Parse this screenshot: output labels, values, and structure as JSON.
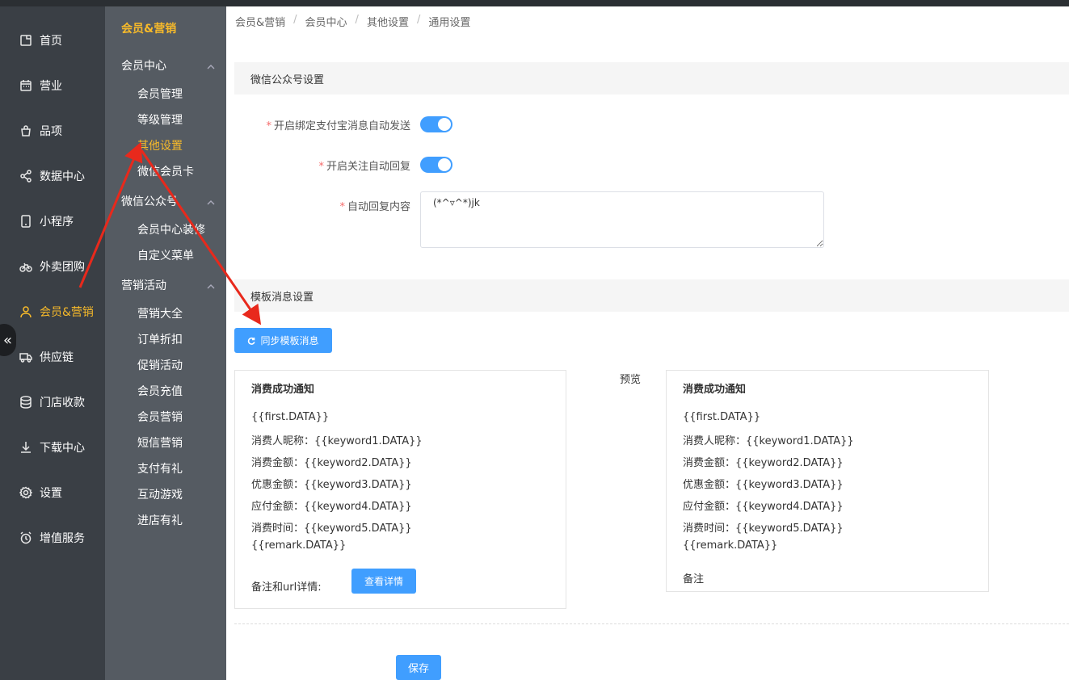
{
  "nav_primary": [
    {
      "label": "首页",
      "icon": "home-icon"
    },
    {
      "label": "营业",
      "icon": "calendar-icon"
    },
    {
      "label": "品项",
      "icon": "bag-icon"
    },
    {
      "label": "数据中心",
      "icon": "share-icon"
    },
    {
      "label": "小程序",
      "icon": "tablet-icon"
    },
    {
      "label": "外卖团购",
      "icon": "bicycle-icon"
    },
    {
      "label": "会员&营销",
      "icon": "user-icon"
    },
    {
      "label": "供应链",
      "icon": "truck-icon"
    },
    {
      "label": "门店收款",
      "icon": "database-icon"
    },
    {
      "label": "下载中心",
      "icon": "download-icon"
    },
    {
      "label": "设置",
      "icon": "gear-icon"
    },
    {
      "label": "增值服务",
      "icon": "alarm-icon"
    }
  ],
  "nav_secondary": {
    "heading": "会员&营销",
    "groups": [
      {
        "label": "会员中心",
        "items": [
          "会员管理",
          "等级管理",
          "其他设置",
          "微信会员卡"
        ]
      },
      {
        "label": "微信公众号",
        "items": [
          "会员中心装修",
          "自定义菜单"
        ]
      },
      {
        "label": "营销活动",
        "items": [
          "营销大全",
          "订单折扣",
          "促销活动",
          "会员充值",
          "会员营销",
          "短信营销",
          "支付有礼",
          "互动游戏",
          "进店有礼"
        ]
      }
    ]
  },
  "breadcrumb": [
    "会员&营销",
    "会员中心",
    "其他设置",
    "通用设置"
  ],
  "breadcrumb_sep": "/",
  "wechat_section": {
    "title": "微信公众号设置",
    "required_mark": "*",
    "alipay_label": "开启绑定支付宝消息自动发送",
    "follow_label": "开启关注自动回复",
    "reply_label": "自动回复内容",
    "reply_value": "(*^▿^*)jk"
  },
  "template_section": {
    "title": "模板消息设置",
    "sync_button": "同步模板消息",
    "preview_label": "预览",
    "card": {
      "title": "消费成功通知",
      "lines": [
        "{{first.DATA}}",
        "消费人昵称：{{keyword1.DATA}}",
        "消费金额：{{keyword2.DATA}}",
        "优惠金额：{{keyword3.DATA}}",
        "应付金额：{{keyword4.DATA}}",
        "消费时间：{{keyword5.DATA}}",
        "{{remark.DATA}}"
      ],
      "remark_label": "备注和url详情:",
      "detail_button": "查看详情"
    },
    "preview": {
      "title": "消费成功通知",
      "lines": [
        "{{first.DATA}}",
        "消费人昵称：{{keyword1.DATA}}",
        "消费金额：{{keyword2.DATA}}",
        "优惠金额：{{keyword3.DATA}}",
        "应付金额：{{keyword4.DATA}}",
        "消费时间：{{keyword5.DATA}}",
        "{{remark.DATA}}"
      ],
      "remark": "备注"
    }
  },
  "save_button": "保存",
  "collapse_glyph": "«",
  "colors": {
    "accent": "#409eff",
    "highlight": "#f7ba2a",
    "annotation": "#e8291c"
  }
}
